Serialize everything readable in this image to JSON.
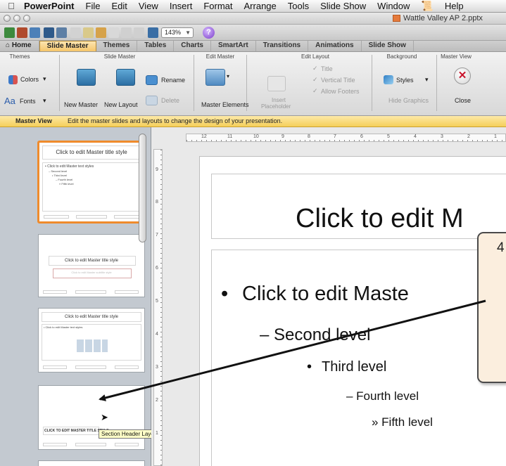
{
  "menubar": {
    "app": "PowerPoint",
    "items": [
      "File",
      "Edit",
      "View",
      "Insert",
      "Format",
      "Arrange",
      "Tools",
      "Slide Show",
      "Window",
      "Help"
    ]
  },
  "window": {
    "title": "Wattle Valley AP 2.pptx"
  },
  "toolbar": {
    "zoom": "143%"
  },
  "ribbon_tabs": [
    "Home",
    "Slide Master",
    "Themes",
    "Tables",
    "Charts",
    "SmartArt",
    "Transitions",
    "Animations",
    "Slide Show"
  ],
  "ribbon": {
    "groups": {
      "themes": "Themes",
      "slide_master": "Slide Master",
      "edit_master": "Edit Master",
      "edit_layout": "Edit Layout",
      "background": "Background",
      "master_view": "Master View"
    },
    "buttons": {
      "colors": "Colors",
      "fonts": "Fonts",
      "new_master": "New Master",
      "new_layout": "New Layout",
      "rename": "Rename",
      "delete": "Delete",
      "master_elements": "Master Elements",
      "insert_placeholder_1": "Insert",
      "insert_placeholder_2": "Placeholder",
      "title": "Title",
      "vertical_title": "Vertical Title",
      "allow_footers": "Allow Footers",
      "styles": "Styles",
      "hide_graphics": "Hide Graphics",
      "close": "Close"
    }
  },
  "message_bar": {
    "label": "Master View",
    "text": "Edit the master slides and layouts to change the design of your presentation."
  },
  "thumbnails": {
    "master_title": "Click to edit Master title style",
    "master_body": "• Click to edit Master text styles",
    "master_body_2": "– Second level",
    "master_body_3": "• Third level",
    "master_body_4": "– Fourth level",
    "master_body_5": "» Fifth level",
    "layout2_title": "Click to edit Master title style",
    "layout2_sub": "Click to edit Master subtitle style",
    "layout3_title": "Click to edit Master title style",
    "layout3_body": "• Click to edit Master text styles",
    "layout4_title": "CLICK TO EDIT MASTER TITLE STYLE"
  },
  "tooltip": "Section Header Layout: used by no slides",
  "rulers": {
    "horizontal": [
      "12",
      "11",
      "10",
      "9",
      "8",
      "7",
      "6",
      "5",
      "4",
      "3",
      "2",
      "1"
    ],
    "vertical": [
      "9",
      "8",
      "7",
      "6",
      "5",
      "4",
      "3",
      "2",
      "1"
    ]
  },
  "slide": {
    "title": "Click to edit M",
    "level1": "Click to edit Maste",
    "level2": "– Second level",
    "level3": "Third level",
    "level4": "– Fourth level",
    "level5": "» Fifth level"
  },
  "callout": {
    "number": "4"
  },
  "colors": {
    "accent": "#ef8b2c",
    "message_bar": "#f5cf5a",
    "pane": "#c3c9d0"
  }
}
